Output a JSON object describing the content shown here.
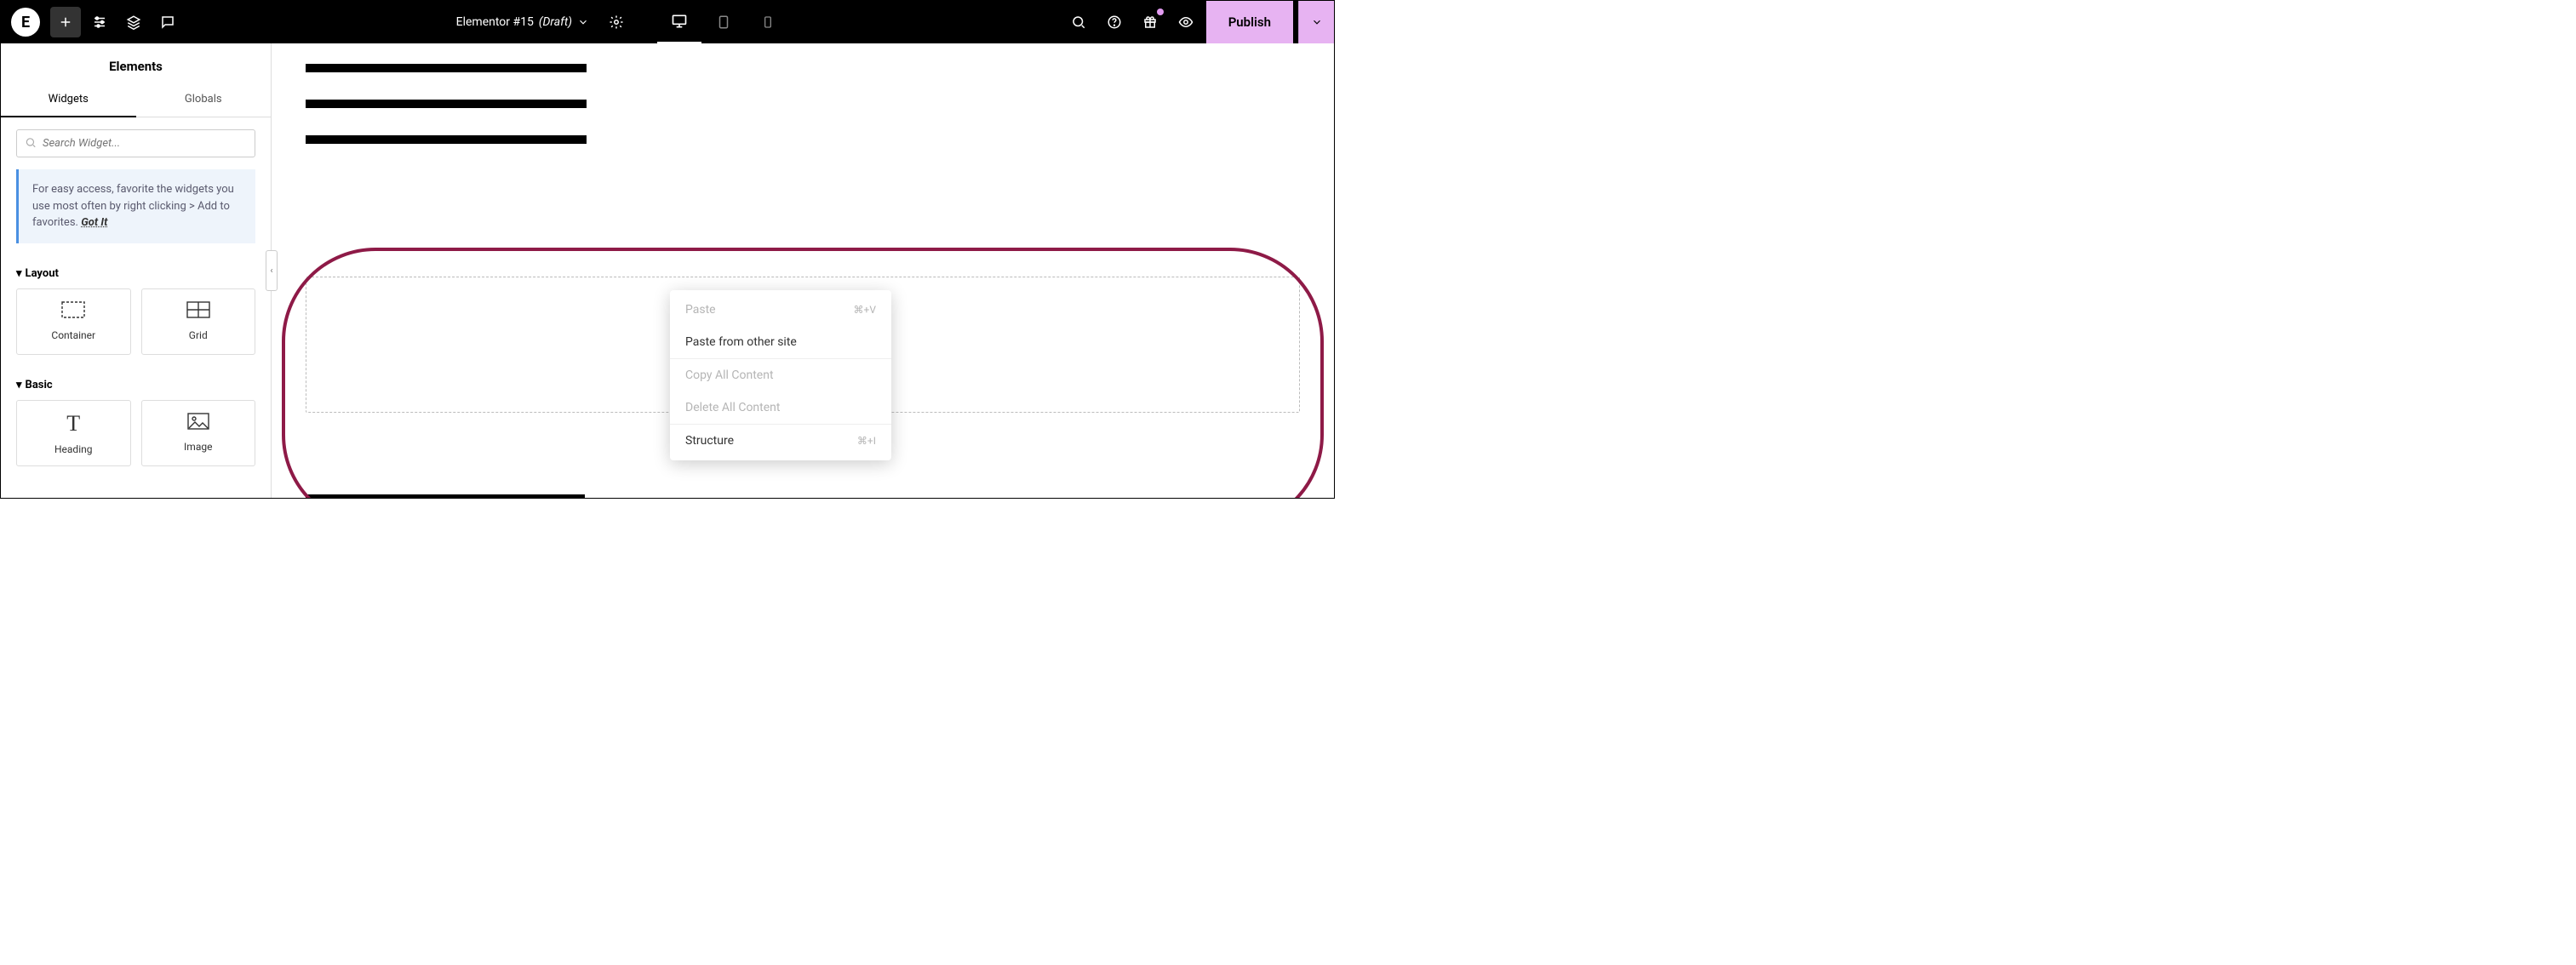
{
  "topbar": {
    "doc_title": "Elementor #15",
    "doc_status": "(Draft)",
    "publish_label": "Publish"
  },
  "panel": {
    "title": "Elements",
    "tabs": {
      "widgets": "Widgets",
      "globals": "Globals"
    },
    "search_placeholder": "Search Widget...",
    "tip_text": "For easy access, favorite the widgets you use most often by right clicking > Add to favorites.",
    "tip_gotit": "Got It",
    "sections": {
      "layout": {
        "label": "Layout",
        "items": [
          "Container",
          "Grid"
        ]
      },
      "basic": {
        "label": "Basic",
        "items": [
          "Heading",
          "Image"
        ]
      }
    }
  },
  "dropzone": {
    "buttons": [
      "plus",
      "folder",
      "ai"
    ]
  },
  "context_menu": {
    "items": [
      {
        "label": "Paste",
        "shortcut": "⌘+V",
        "disabled": true
      },
      {
        "label": "Paste from other site",
        "shortcut": "",
        "disabled": false
      },
      {
        "sep": true
      },
      {
        "label": "Copy All Content",
        "shortcut": "",
        "disabled": true
      },
      {
        "label": "Delete All Content",
        "shortcut": "",
        "disabled": true
      },
      {
        "sep": true
      },
      {
        "label": "Structure",
        "shortcut": "⌘+I",
        "disabled": false
      }
    ]
  }
}
